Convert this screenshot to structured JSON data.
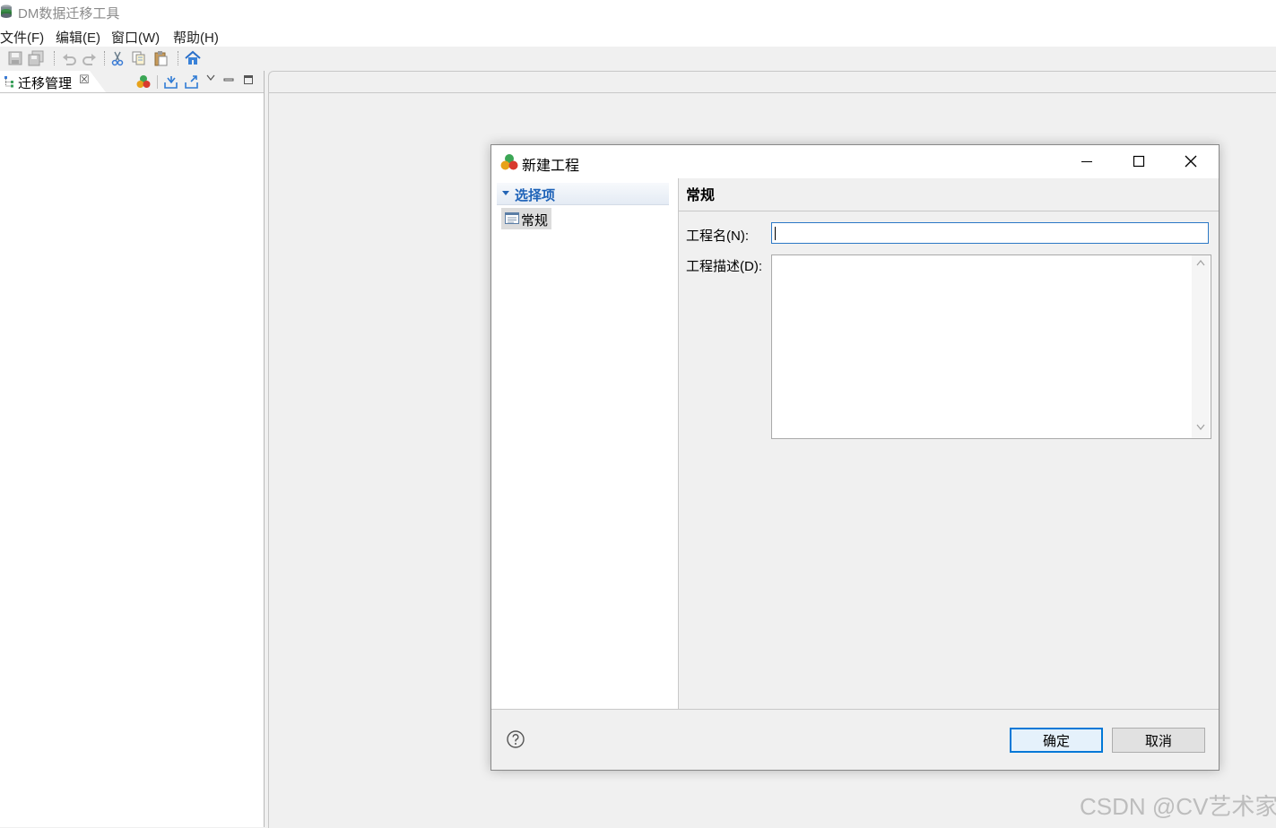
{
  "app": {
    "title": "DM数据迁移工具"
  },
  "menu": {
    "items": [
      "文件(F)",
      "编辑(E)",
      "窗口(W)",
      "帮助(H)"
    ]
  },
  "toolbar": {
    "icons": [
      "save-icon",
      "save-all-icon",
      "undo-icon",
      "redo-icon",
      "cut-icon",
      "copy-icon",
      "paste-icon",
      "home-icon"
    ]
  },
  "left_panel": {
    "tab_label": "迁移管理",
    "tab_close": "☒",
    "icons": [
      "new-project-icon",
      "import-icon",
      "export-icon",
      "view-menu-icon",
      "minimize-icon",
      "maximize-icon"
    ]
  },
  "dialog": {
    "title": "新建工程",
    "nav": {
      "header": "选择项",
      "items": [
        "常规"
      ]
    },
    "section_title": "常规",
    "fields": {
      "name_label": "工程名(N):",
      "name_value": "",
      "desc_label": "工程描述(D):",
      "desc_value": ""
    },
    "buttons": {
      "ok": "确定",
      "cancel": "取消"
    }
  },
  "watermark": "CSDN @CV艺术家"
}
